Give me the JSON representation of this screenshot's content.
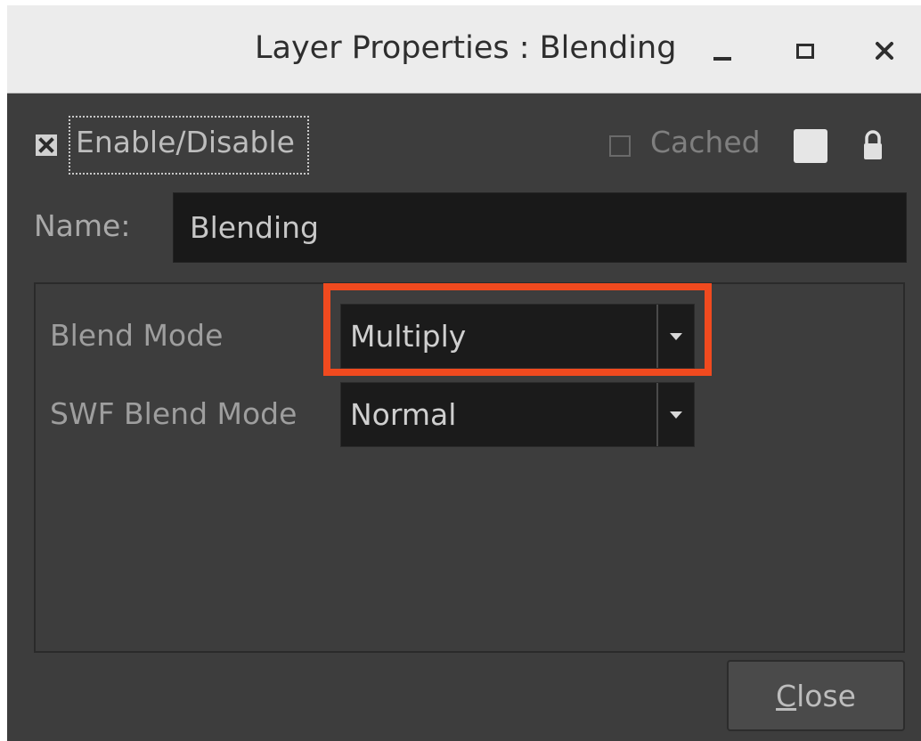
{
  "window": {
    "title": "Layer Properties : Blending"
  },
  "toolbar": {
    "enable_label": "Enable/Disable",
    "enable_checked": true,
    "cached_label": "Cached",
    "cached_checked": false
  },
  "name_field": {
    "label": "Name:",
    "value": "Blending"
  },
  "blend": {
    "blend_mode_label": "Blend Mode",
    "blend_mode_value": "Multiply",
    "swf_blend_mode_label": "SWF Blend Mode",
    "swf_blend_mode_value": "Normal"
  },
  "footer": {
    "close_label_prefix": "",
    "close_mnemonic": "C",
    "close_label_rest": "lose"
  },
  "colors": {
    "highlight": "#f04a1f",
    "background": "#3d3d3d",
    "field_bg": "#1b1b1b"
  },
  "icons": {
    "minimize": "minimize-icon",
    "maximize": "maximize-icon",
    "close": "close-icon",
    "lock": "lock-icon",
    "color_swatch": "color-swatch-icon",
    "dropdown": "chevron-down-icon"
  }
}
